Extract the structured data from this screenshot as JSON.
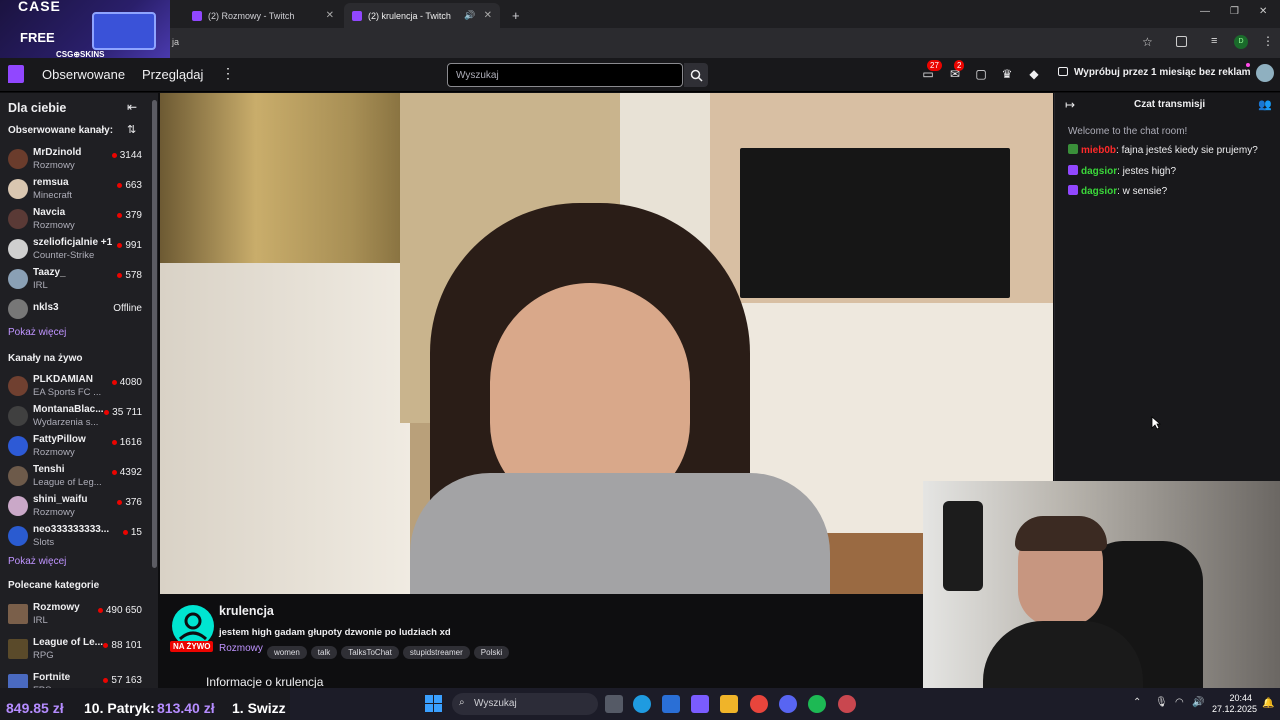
{
  "browser": {
    "tabs": [
      {
        "label": "(2) Rozmowy - Twitch",
        "active": false
      },
      {
        "label": "(2) krulencja - Twitch",
        "active": true
      }
    ],
    "partial_tab_text": "et",
    "address_partial": "ja"
  },
  "promo": {
    "title": "CASE",
    "sub": "FREE",
    "brand": "CSG⊕SKINS"
  },
  "topnav": {
    "following": "Obserwowane",
    "browse": "Przeglądaj",
    "search_placeholder": "Wyszukaj",
    "notifications_count": "27",
    "whispers_count": "2",
    "try_ad_free": "Wypróbuj przez 1 miesiąc bez reklam"
  },
  "sidebar": {
    "title": "Dla ciebie",
    "followed_heading": "Obserwowane kanały:",
    "followed": [
      {
        "name": "MrDzinold",
        "game": "Rozmowy",
        "viewers": "3144"
      },
      {
        "name": "remsua",
        "game": "Minecraft",
        "viewers": "663"
      },
      {
        "name": "Navcia",
        "game": "Rozmowy",
        "viewers": "379"
      },
      {
        "name": "szelioficjalnie +1",
        "game": "Counter-Strike",
        "viewers": "991"
      },
      {
        "name": "Taazy_",
        "game": "IRL",
        "viewers": "578"
      },
      {
        "name": "nkls3",
        "game": "",
        "viewers": "Offline"
      }
    ],
    "show_more_1": "Pokaż więcej",
    "live_heading": "Kanały na żywo",
    "live": [
      {
        "name": "PLKDAMIAN",
        "game": "EA Sports FC ...",
        "viewers": "4080"
      },
      {
        "name": "MontanaBlac...",
        "game": "Wydarzenia s...",
        "viewers": "35 711"
      },
      {
        "name": "FattyPillow",
        "game": "Rozmowy",
        "viewers": "1616"
      },
      {
        "name": "Tenshi",
        "game": "League of Leg...",
        "viewers": "4392"
      },
      {
        "name": "shini_waifu",
        "game": "Rozmowy",
        "viewers": "376"
      },
      {
        "name": "neo333333333...",
        "game": "Slots",
        "viewers": "15"
      }
    ],
    "show_more_2": "Pokaż więcej",
    "categories_heading": "Polecane kategorie",
    "categories": [
      {
        "name": "Rozmowy",
        "tag": "IRL",
        "viewers": "490 650"
      },
      {
        "name": "League of Le...",
        "tag": "RPG",
        "viewers": "88 101"
      },
      {
        "name": "Fortnite",
        "tag": "FPS",
        "viewers": "57 163"
      }
    ]
  },
  "stream": {
    "channel": "krulencja",
    "title": "jestem high gadam głupoty dzwonie po ludziach xd",
    "live_label": "NA ŻYWO",
    "category": "Rozmowy",
    "tags": [
      "women",
      "talk",
      "TalksToChat",
      "stupidstreamer",
      "Polski"
    ],
    "about": "Informacje o krulencja"
  },
  "chat": {
    "title": "Czat transmisji",
    "welcome": "Welcome to the chat room!",
    "messages": [
      {
        "user": "mieb0b",
        "text": ": fajna jesteś kiedy sie prujemy?",
        "color": "#ff2a2a"
      },
      {
        "user": "dagsior",
        "text": ": jestes high?",
        "color": "#3ad63a"
      },
      {
        "user": "dagsior",
        "text": ": w sensie?",
        "color": "#3ad63a"
      }
    ]
  },
  "taskbar": {
    "ticker": [
      {
        "text": "849.85 zł",
        "color": "#b58cff"
      },
      {
        "text": "10. Patryk:",
        "color": "#ffffff"
      },
      {
        "text": "813.40 zł",
        "color": "#b58cff"
      },
      {
        "text": "1. Swizz",
        "color": "#ffffff"
      }
    ],
    "search": "Wyszukaj",
    "time": "20:44",
    "date": "27.12.2025"
  },
  "colors": {
    "accent": "#9147ff",
    "live": "#eb0400",
    "link": "#bf94ff"
  }
}
